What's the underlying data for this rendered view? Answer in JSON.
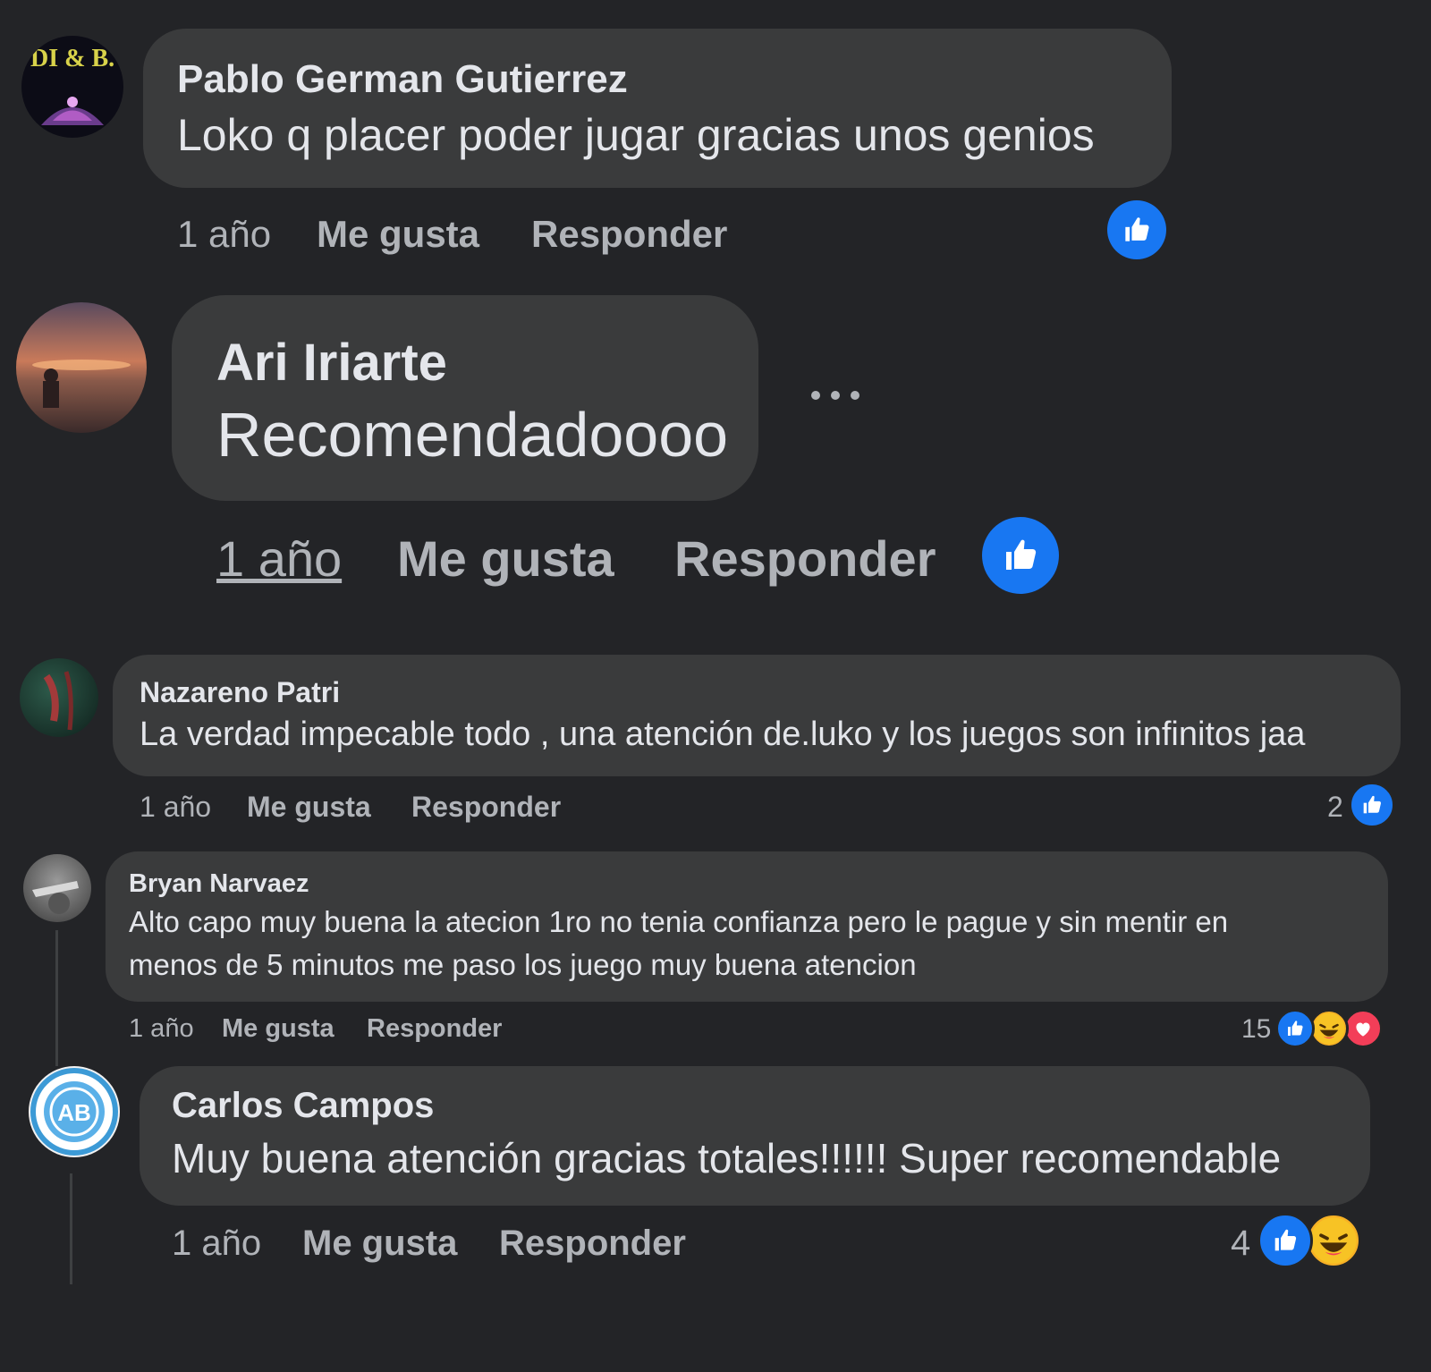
{
  "comments": [
    {
      "name": "Pablo German Gutierrez",
      "text": "Loko q placer poder jugar gracias unos genios",
      "time": "1 año",
      "like_label": "Me gusta",
      "reply_label": "Responder",
      "reaction_count": "",
      "avatar_text": "DI & B."
    },
    {
      "name": "Ari Iriarte",
      "text": "Recomendadoooo",
      "time": "1 año",
      "like_label": "Me gusta",
      "reply_label": "Responder",
      "more_label": "...",
      "reaction_count": ""
    },
    {
      "name": "Nazareno Patri",
      "text": "La verdad impecable todo , una atención de.luko y los juegos son infinitos jaa",
      "time": "1 año",
      "like_label": "Me gusta",
      "reply_label": "Responder",
      "reaction_count": "2"
    },
    {
      "name": "Bryan Narvaez",
      "text_line1": "Alto capo muy buena la atecion 1ro no tenia confianza pero le pague y sin mentir en",
      "text_line2": "menos de 5 minutos me paso los juego muy buena atencion",
      "time": "1 año",
      "like_label": "Me gusta",
      "reply_label": "Responder",
      "reaction_count": "15"
    },
    {
      "name": "Carlos Campos",
      "text": "Muy buena atención gracias totales!!!!!! Super recomendable",
      "time": "1 año",
      "like_label": "Me gusta",
      "reply_label": "Responder",
      "reaction_count": "4"
    }
  ],
  "colors": {
    "background": "#232427",
    "bubble": "#3a3b3c",
    "primary_text": "#e4e6eb",
    "secondary_text": "#b0b3b8",
    "like_blue": "#1877f2",
    "haha_yellow": "#f7b125",
    "love_red": "#f33e58"
  },
  "icons": [
    "like-icon",
    "haha-icon",
    "love-icon",
    "more-options-icon"
  ]
}
